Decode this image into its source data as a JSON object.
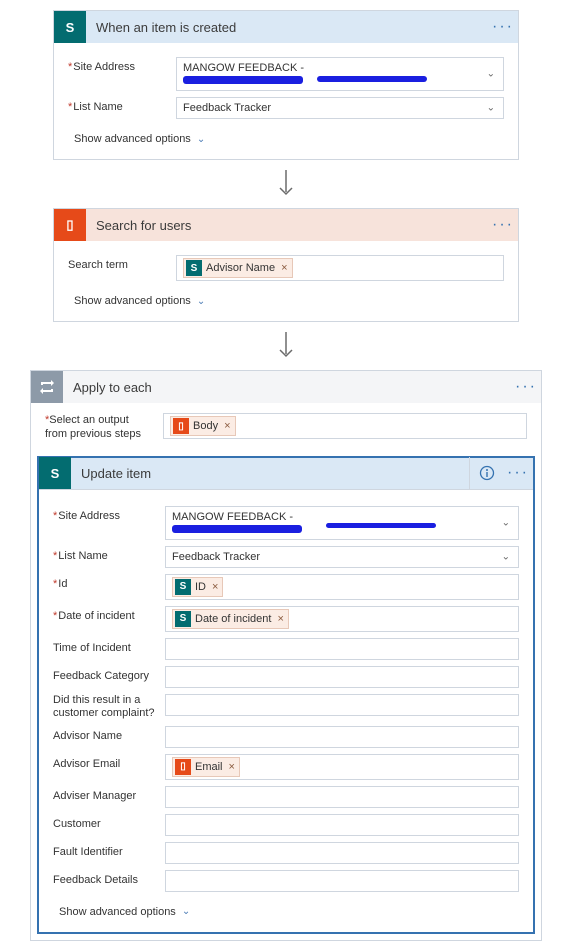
{
  "step1": {
    "title": "When an item is created",
    "fields": {
      "siteAddressLabel": "Site Address",
      "siteAddressValue": "MANGOW FEEDBACK -",
      "listNameLabel": "List Name",
      "listNameValue": "Feedback Tracker"
    },
    "advanced": "Show advanced options"
  },
  "step2": {
    "title": "Search for users",
    "fields": {
      "searchTermLabel": "Search term",
      "tokenLabel": "Advisor Name"
    },
    "advanced": "Show advanced options"
  },
  "step3": {
    "title": "Apply to each",
    "selectLabelLine1": "Select an output",
    "selectLabelLine2": "from previous steps",
    "tokenLabel": "Body",
    "inner": {
      "title": "Update item",
      "fields": {
        "siteAddressLabel": "Site Address",
        "siteAddressValue": "MANGOW FEEDBACK -",
        "listNameLabel": "List Name",
        "listNameValue": "Feedback Tracker",
        "idLabel": "Id",
        "idToken": "ID",
        "dateLabel": "Date of incident",
        "dateToken": "Date of incident",
        "timeLabel": "Time of Incident",
        "catLabel": "Feedback Category",
        "complaintLabel": "Did this result in a customer complaint?",
        "advNameLabel": "Advisor Name",
        "advEmailLabel": "Advisor Email",
        "advEmailToken": "Email",
        "advMgrLabel": "Adviser Manager",
        "custLabel": "Customer",
        "faultLabel": "Fault Identifier",
        "detailsLabel": "Feedback Details"
      },
      "advanced": "Show advanced options"
    }
  }
}
